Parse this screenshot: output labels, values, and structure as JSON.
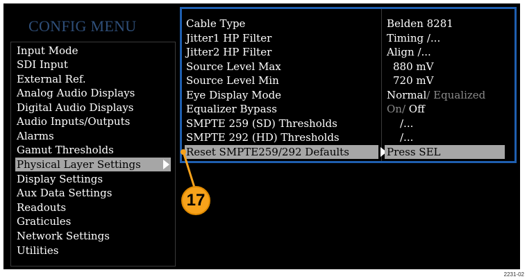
{
  "menu": {
    "title": "CONFIG MENU",
    "items": [
      {
        "label": "Input Mode"
      },
      {
        "label": "SDI Input"
      },
      {
        "label": "External Ref."
      },
      {
        "label": "Analog Audio Displays"
      },
      {
        "label": "Digital Audio Displays"
      },
      {
        "label": "Audio Inputs/Outputs"
      },
      {
        "label": "Alarms"
      },
      {
        "label": "Gamut Thresholds"
      },
      {
        "label": "Physical Layer Settings",
        "selected": true
      },
      {
        "label": "Display Settings"
      },
      {
        "label": "Aux Data Settings"
      },
      {
        "label": "Readouts"
      },
      {
        "label": "Graticules"
      },
      {
        "label": "Network Settings"
      },
      {
        "label": "Utilities"
      }
    ]
  },
  "settings": {
    "rows": [
      {
        "param": "Cable Type",
        "value": "Belden 8281"
      },
      {
        "param": "Jitter1 HP Filter",
        "value": "Timing /..."
      },
      {
        "param": "Jitter2 HP Filter",
        "value": "Align /..."
      },
      {
        "param": "Source Level Max",
        "value": "880 mV"
      },
      {
        "param": "Source Level Min",
        "value": "720 mV"
      },
      {
        "param": "Eye Display Mode",
        "value_on": "Normal",
        "value_off": "/ Equalized"
      },
      {
        "param": "Equalizer Bypass",
        "value_off": "On/",
        "value_on": " Off"
      },
      {
        "param": "SMPTE 259 (SD) Thresholds",
        "value": "/..."
      },
      {
        "param": "SMPTE 292 (HD) Thresholds",
        "value": "/..."
      },
      {
        "param": "Reset SMPTE259/292 Defaults",
        "value": "Press SEL",
        "selected": true
      }
    ]
  },
  "callout": {
    "number": "17"
  },
  "figure_id": "2231-02",
  "colors": {
    "panel_border": "#1f5fb0",
    "highlight": "#a6a6a6",
    "callout": "#f7a21b",
    "title": "#2f4f7a"
  }
}
